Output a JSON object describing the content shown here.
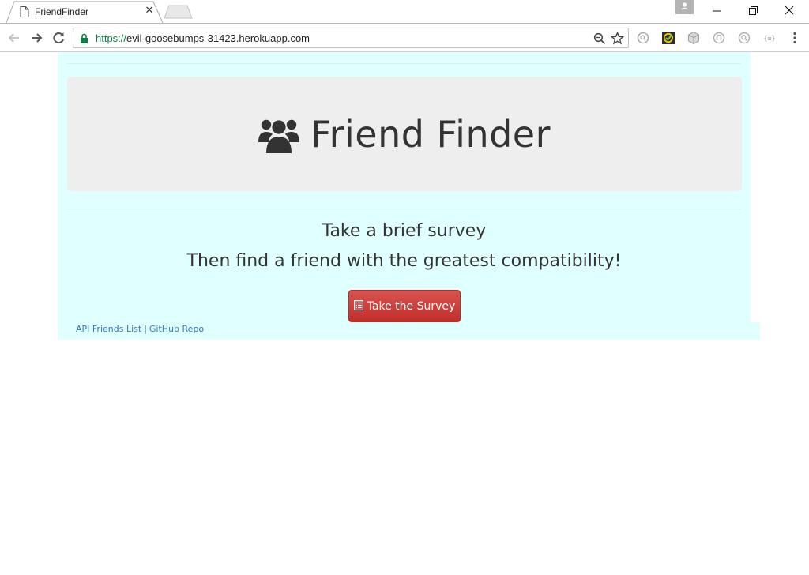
{
  "browser": {
    "tab_title": "FriendFinder",
    "close_tab_glyph": "✕",
    "url_scheme": "https://",
    "url_host": "evil-goosebumps-31423.herokuapp.com",
    "extensions": [
      "ext-search-icon",
      "ext-checklist-icon",
      "ext-cube-icon",
      "ext-shield-icon",
      "ext-magnifier-icon",
      "ext-json-icon"
    ]
  },
  "page": {
    "brand_title": "Friend Finder",
    "brand_icon": "users-icon",
    "lead_line_1": "Take a brief survey",
    "lead_line_2": "Then find a friend with the greatest compatibility!",
    "survey_button_label": "Take the Survey",
    "footer": {
      "api_link": "API Friends List",
      "separator": "|",
      "repo_link": "GitHub Repo"
    }
  },
  "colors": {
    "container_bg": "#e0ffff",
    "jumbotron_bg": "#eeeeee",
    "button_red": "#d9534f",
    "link_blue": "#337ab7"
  }
}
